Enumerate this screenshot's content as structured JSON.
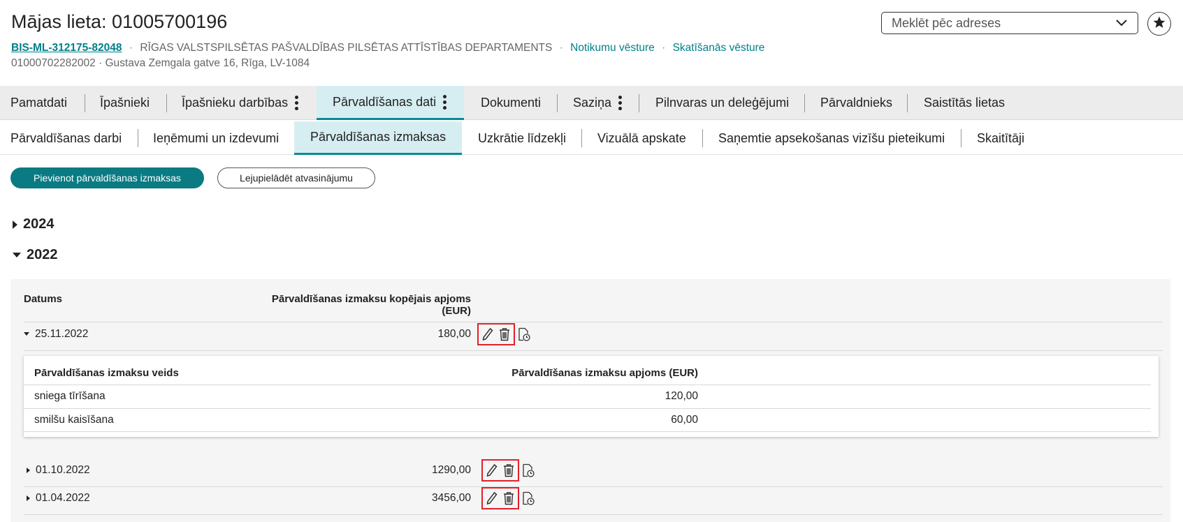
{
  "header": {
    "title": "Mājas lieta: 01005700196",
    "case_id": "BIS-ML-312175-82048",
    "department": "RĪGAS VALSTSPILSĒTAS PAŠVALDĪBAS PILSĒTAS ATTĪSTĪBAS DEPARTAMENTS",
    "events_link": "Notikumu vēsture",
    "views_link": "Skatīšanās vēsture",
    "sub_line": "01000702282002 · Gustava Zemgala gatve 16, Rīga, LV-1084",
    "separator": "·"
  },
  "search": {
    "placeholder": "Meklēt pēc adreses"
  },
  "main_tabs": [
    {
      "label": "Pamatdati"
    },
    {
      "label": "Īpašnieki"
    },
    {
      "label": "Īpašnieku darbības"
    },
    {
      "label": "Pārvaldīšanas dati"
    },
    {
      "label": "Dokumenti"
    },
    {
      "label": "Saziņa"
    },
    {
      "label": "Pilnvaras un deleģējumi"
    },
    {
      "label": "Pārvaldnieks"
    },
    {
      "label": "Saistītās lietas"
    }
  ],
  "sub_tabs": [
    {
      "label": "Pārvaldīšanas darbi"
    },
    {
      "label": "Ieņēmumi un izdevumi"
    },
    {
      "label": "Pārvaldīšanas izmaksas"
    },
    {
      "label": "Uzkrātie līdzekļi"
    },
    {
      "label": "Vizuālā apskate"
    },
    {
      "label": "Saņemtie apsekošanas vizīšu pieteikumi"
    },
    {
      "label": "Skaitītāji"
    }
  ],
  "active_main_tab": "Pārvaldīšanas dati",
  "active_sub_tab": "Pārvaldīšanas izmaksas",
  "buttons": {
    "add": "Pievienot pārvaldīšanas izmaksas",
    "download": "Lejupielādēt atvasinājumu"
  },
  "years": [
    {
      "label": "2024",
      "expanded": false
    },
    {
      "label": "2022",
      "expanded": true
    }
  ],
  "table": {
    "col_date": "Datums",
    "col_total": "Pārvaldīšanas izmaksu kopējais apjoms (EUR)",
    "rows": [
      {
        "date": "25.11.2022",
        "total": "180,00",
        "expanded": true
      },
      {
        "date": "01.10.2022",
        "total": "1290,00",
        "expanded": false
      },
      {
        "date": "01.04.2022",
        "total": "3456,00",
        "expanded": false
      }
    ]
  },
  "detail": {
    "col_type": "Pārvaldīšanas izmaksu veids",
    "col_amount": "Pārvaldīšanas izmaksu apjoms (EUR)",
    "rows": [
      {
        "type": "sniega tīrīšana",
        "amount": "120,00"
      },
      {
        "type": "smilšu kaisīšana",
        "amount": "60,00"
      }
    ]
  },
  "icons": {
    "edit": "pencil-icon",
    "delete": "trash-icon",
    "history": "document-clock-icon",
    "favorite": "star-icon",
    "dropdown": "chevron-down-icon"
  },
  "colors": {
    "accent": "#0a7b82",
    "link": "#00808a",
    "active_tab_bg": "#d6eef1",
    "highlight": "#e3202a"
  }
}
